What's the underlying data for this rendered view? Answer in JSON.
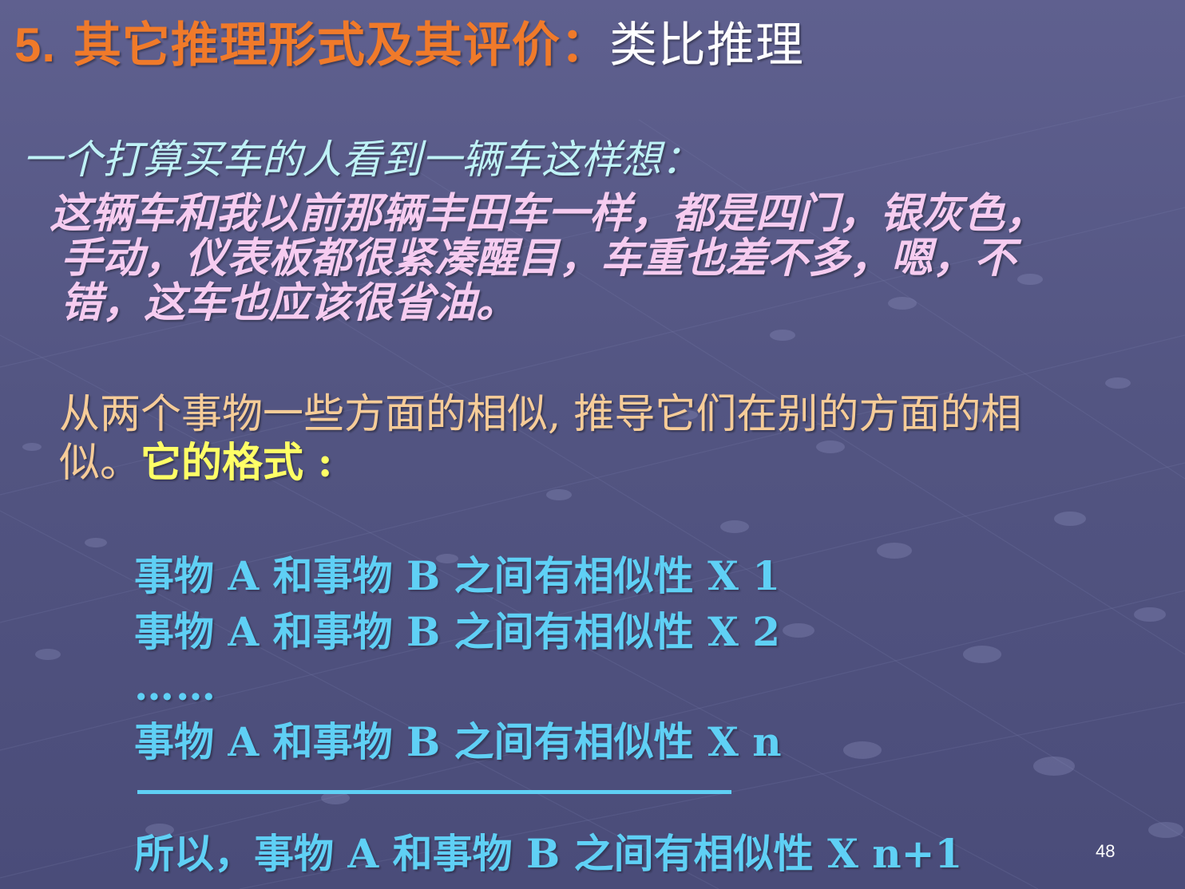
{
  "title": {
    "number": "5.",
    "main": "其它推理形式及其评价：",
    "sub": "类比推理"
  },
  "scenario": {
    "intro": "一个打算买车的人看到一辆车这样想：",
    "line1": "这辆车和我以前那辆丰田车一样，都是四门，银灰色，",
    "line2": "手动，仪表板都很紧凑醒目，车重也差不多，嗯，不",
    "line3": "错，这车也应该很省油。"
  },
  "definition": {
    "line1": "从两个事物一些方面的相似, 推导它们在别的方面的相",
    "line2_start": "似。",
    "line2_highlight": "它的格式 :"
  },
  "format": {
    "premise1": "事物 A 和事物 B 之间有相似性 X 1",
    "premise2": "事物 A 和事物 B 之间有相似性 X 2",
    "ellipsis": "……",
    "premise_n": "事物 A 和事物 B 之间有相似性 X n",
    "conclusion": "所以，事物 A 和事物 B 之间有相似性 X n+1"
  },
  "page_number": "48"
}
